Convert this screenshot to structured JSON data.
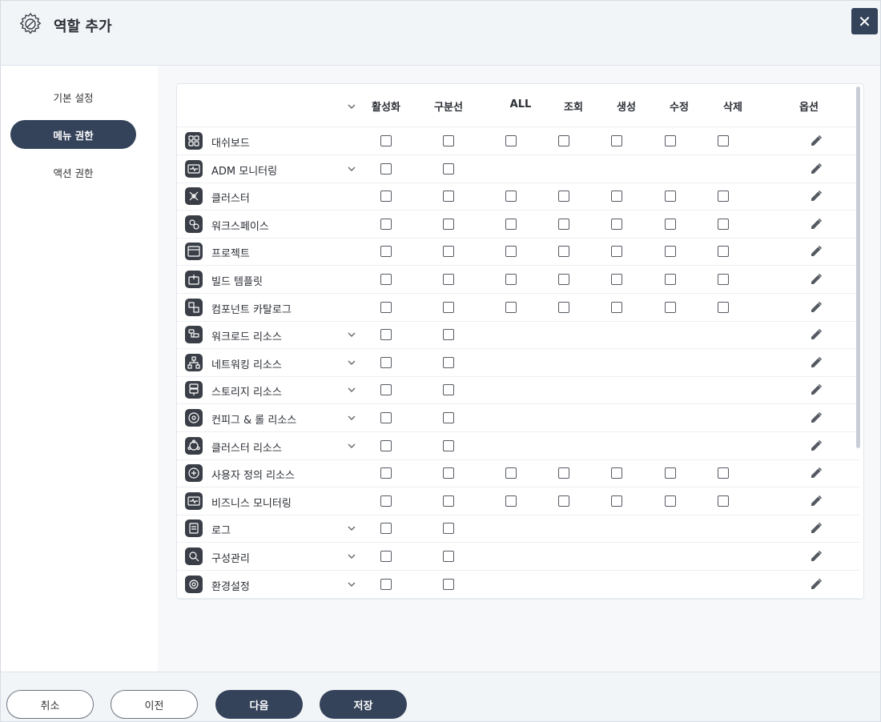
{
  "dialog": {
    "title": "역할 추가",
    "close_label": "✕"
  },
  "sidebar": {
    "items": [
      {
        "label": "기본 설정",
        "active": false
      },
      {
        "label": "메뉴 권한",
        "active": true
      },
      {
        "label": "액션 권한",
        "active": false
      }
    ]
  },
  "table": {
    "headers": [
      "활성화",
      "구분선",
      "ALL",
      "조회",
      "생성",
      "수정",
      "삭제",
      "옵션"
    ],
    "rows": [
      {
        "label": "대쉬보드",
        "icon": "dashboard-icon",
        "expandable": false,
        "full": true
      },
      {
        "label": "ADM 모니터링",
        "icon": "monitor-icon",
        "expandable": true,
        "full": false
      },
      {
        "label": "클러스터",
        "icon": "cluster-icon",
        "expandable": false,
        "full": true
      },
      {
        "label": "워크스페이스",
        "icon": "workspace-icon",
        "expandable": false,
        "full": true
      },
      {
        "label": "프로젝트",
        "icon": "project-icon",
        "expandable": false,
        "full": true
      },
      {
        "label": "빌드 템플릿",
        "icon": "build-template-icon",
        "expandable": false,
        "full": true
      },
      {
        "label": "컴포넌트 카탈로그",
        "icon": "component-catalog-icon",
        "expandable": false,
        "full": true
      },
      {
        "label": "워크로드 리소스",
        "icon": "workload-icon",
        "expandable": true,
        "full": false
      },
      {
        "label": "네트워킹 리소스",
        "icon": "network-icon",
        "expandable": true,
        "full": false
      },
      {
        "label": "스토리지 리소스",
        "icon": "storage-icon",
        "expandable": true,
        "full": false
      },
      {
        "label": "컨피그 & 롤 리소스",
        "icon": "config-role-icon",
        "expandable": true,
        "full": false
      },
      {
        "label": "클러스터 리소스",
        "icon": "cluster-resource-icon",
        "expandable": true,
        "full": false
      },
      {
        "label": "사용자 정의 리소스",
        "icon": "custom-resource-icon",
        "expandable": false,
        "full": true
      },
      {
        "label": "비즈니스 모니터링",
        "icon": "business-monitor-icon",
        "expandable": false,
        "full": true
      },
      {
        "label": "로그",
        "icon": "log-icon",
        "expandable": true,
        "full": false
      },
      {
        "label": "구성관리",
        "icon": "config-manage-icon",
        "expandable": true,
        "full": false
      },
      {
        "label": "환경설정",
        "icon": "settings-icon",
        "expandable": true,
        "full": false
      }
    ]
  },
  "footer": {
    "cancel_label": "취소",
    "prev_label": "이전",
    "next_label": "다음",
    "save_label": "저장"
  },
  "colors": {
    "primary": "#34425a",
    "header_bg": "#f2f5f8"
  }
}
